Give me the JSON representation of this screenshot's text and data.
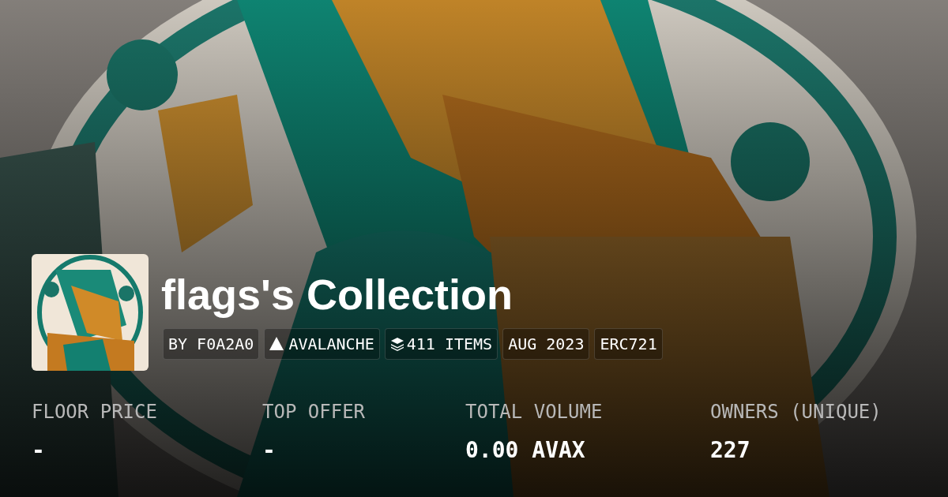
{
  "collection": {
    "title": "flags's Collection",
    "tags": [
      {
        "kind": "text",
        "label": "BY F0A2A0"
      },
      {
        "kind": "chain",
        "label": "AVALANCHE"
      },
      {
        "kind": "items",
        "label": "411 ITEMS"
      },
      {
        "kind": "text",
        "label": "AUG 2023"
      },
      {
        "kind": "text",
        "label": "ERC721"
      }
    ]
  },
  "stats": [
    {
      "label": "FLOOR PRICE",
      "value": "-"
    },
    {
      "label": "TOP OFFER",
      "value": "-"
    },
    {
      "label": "TOTAL VOLUME",
      "value": "0.00 AVAX"
    },
    {
      "label": "OWNERS (UNIQUE)",
      "value": "227"
    }
  ]
}
